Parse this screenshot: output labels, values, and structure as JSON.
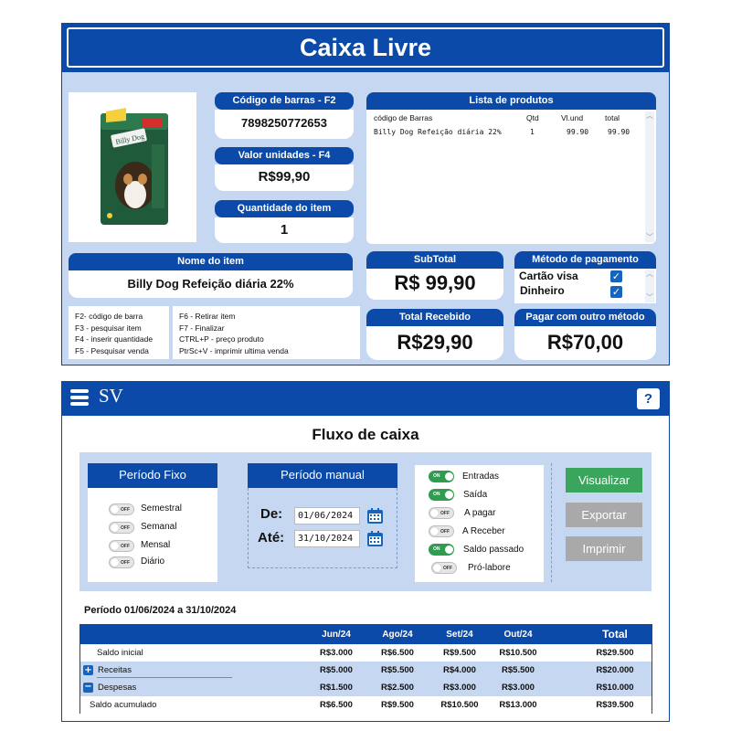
{
  "pos": {
    "title": "Caixa Livre",
    "barcode": {
      "label": "Código de barras - F2",
      "value": "7898250772653"
    },
    "unit_value": {
      "label": "Valor unidades - F4",
      "value": "R$99,90"
    },
    "quantity": {
      "label": "Quantidade do item",
      "value": "1"
    },
    "item_name": {
      "label": "Nome do item",
      "value": "Billy Dog Refeição diária 22%"
    },
    "product_list": {
      "title": "Lista de produtos",
      "headers": [
        "código de Barras",
        "Qtd",
        "Vl.und",
        "total"
      ],
      "rows": [
        [
          "Billy Dog Refeição diária 22%",
          "1",
          "99.90",
          "99.90"
        ]
      ]
    },
    "subtotal": {
      "label": "SubTotal",
      "value": "R$ 99,90"
    },
    "payment": {
      "label": "Método de pagamento",
      "options": [
        {
          "label": "Cartão visa",
          "checked": true
        },
        {
          "label": "Dinheiro",
          "checked": true
        }
      ]
    },
    "total_received": {
      "label": "Total Recebido",
      "value": "R$29,90"
    },
    "other_method": {
      "label": "Pagar com outro método",
      "value": "R$70,00"
    },
    "shortcuts_left": [
      "F2- código de barra",
      "F3 - pesquisar item",
      "F4 - inserir quantidade",
      "F5 - Pesquisar venda"
    ],
    "shortcuts_right": [
      "F6 - Retirar item",
      "F7 - Finalizar",
      "CTRL+P - preço produto",
      "PtrSc+V - imprimir ultima venda"
    ]
  },
  "flow": {
    "logo": "SV",
    "help": "?",
    "title": "Fluxo de caixa",
    "fixed_period": {
      "title": "Período Fixo",
      "options": [
        {
          "label": "Semestral",
          "state": "OFF"
        },
        {
          "label": "Semanal",
          "state": "OFF"
        },
        {
          "label": "Mensal",
          "state": "OFF"
        },
        {
          "label": "Diário",
          "state": "OFF"
        }
      ]
    },
    "manual_period": {
      "title": "Período manual",
      "from_label": "De:",
      "from_value": "01/06/2024",
      "to_label": "Até:",
      "to_value": "31/10/2024"
    },
    "toggles": [
      {
        "label": "Entradas",
        "state": "ON"
      },
      {
        "label": "Saída",
        "state": "ON"
      },
      {
        "label": "A pagar",
        "state": "OFF"
      },
      {
        "label": "A Receber",
        "state": "OFF"
      },
      {
        "label": "Saldo passado",
        "state": "ON"
      },
      {
        "label": "Pró-labore",
        "state": "OFF"
      }
    ],
    "buttons": {
      "view": "Visualizar",
      "export": "Exportar",
      "print": "Imprimir"
    },
    "colors": {
      "primary": "#0b4aa8",
      "view_button": "#3aa55c",
      "disabled_button": "#a9a9a9",
      "panel_bg": "#c6d7f1"
    },
    "period_text": "Período 01/06/2024 a 31/10/2024",
    "table": {
      "headers": [
        "Jun/24",
        "Ago/24",
        "Set/24",
        "Out/24",
        "Total"
      ],
      "rows": [
        {
          "label": "Saldo inicial",
          "values": [
            "R$3.000",
            "R$6.500",
            "R$9.500",
            "R$10.500",
            "R$29.500"
          ]
        },
        {
          "label": "Receitas",
          "icon": "plus",
          "values": [
            "R$5.000",
            "R$5.500",
            "R$4.000",
            "R$5.500",
            "R$20.000"
          ]
        },
        {
          "label": "Despesas",
          "icon": "minus",
          "values": [
            "R$1.500",
            "R$2.500",
            "R$3.000",
            "R$3.000",
            "R$10.000"
          ]
        },
        {
          "label": "Saldo acumulado",
          "values": [
            "R$6.500",
            "R$9.500",
            "R$10.500",
            "R$13.000",
            "R$39.500"
          ]
        }
      ]
    }
  }
}
